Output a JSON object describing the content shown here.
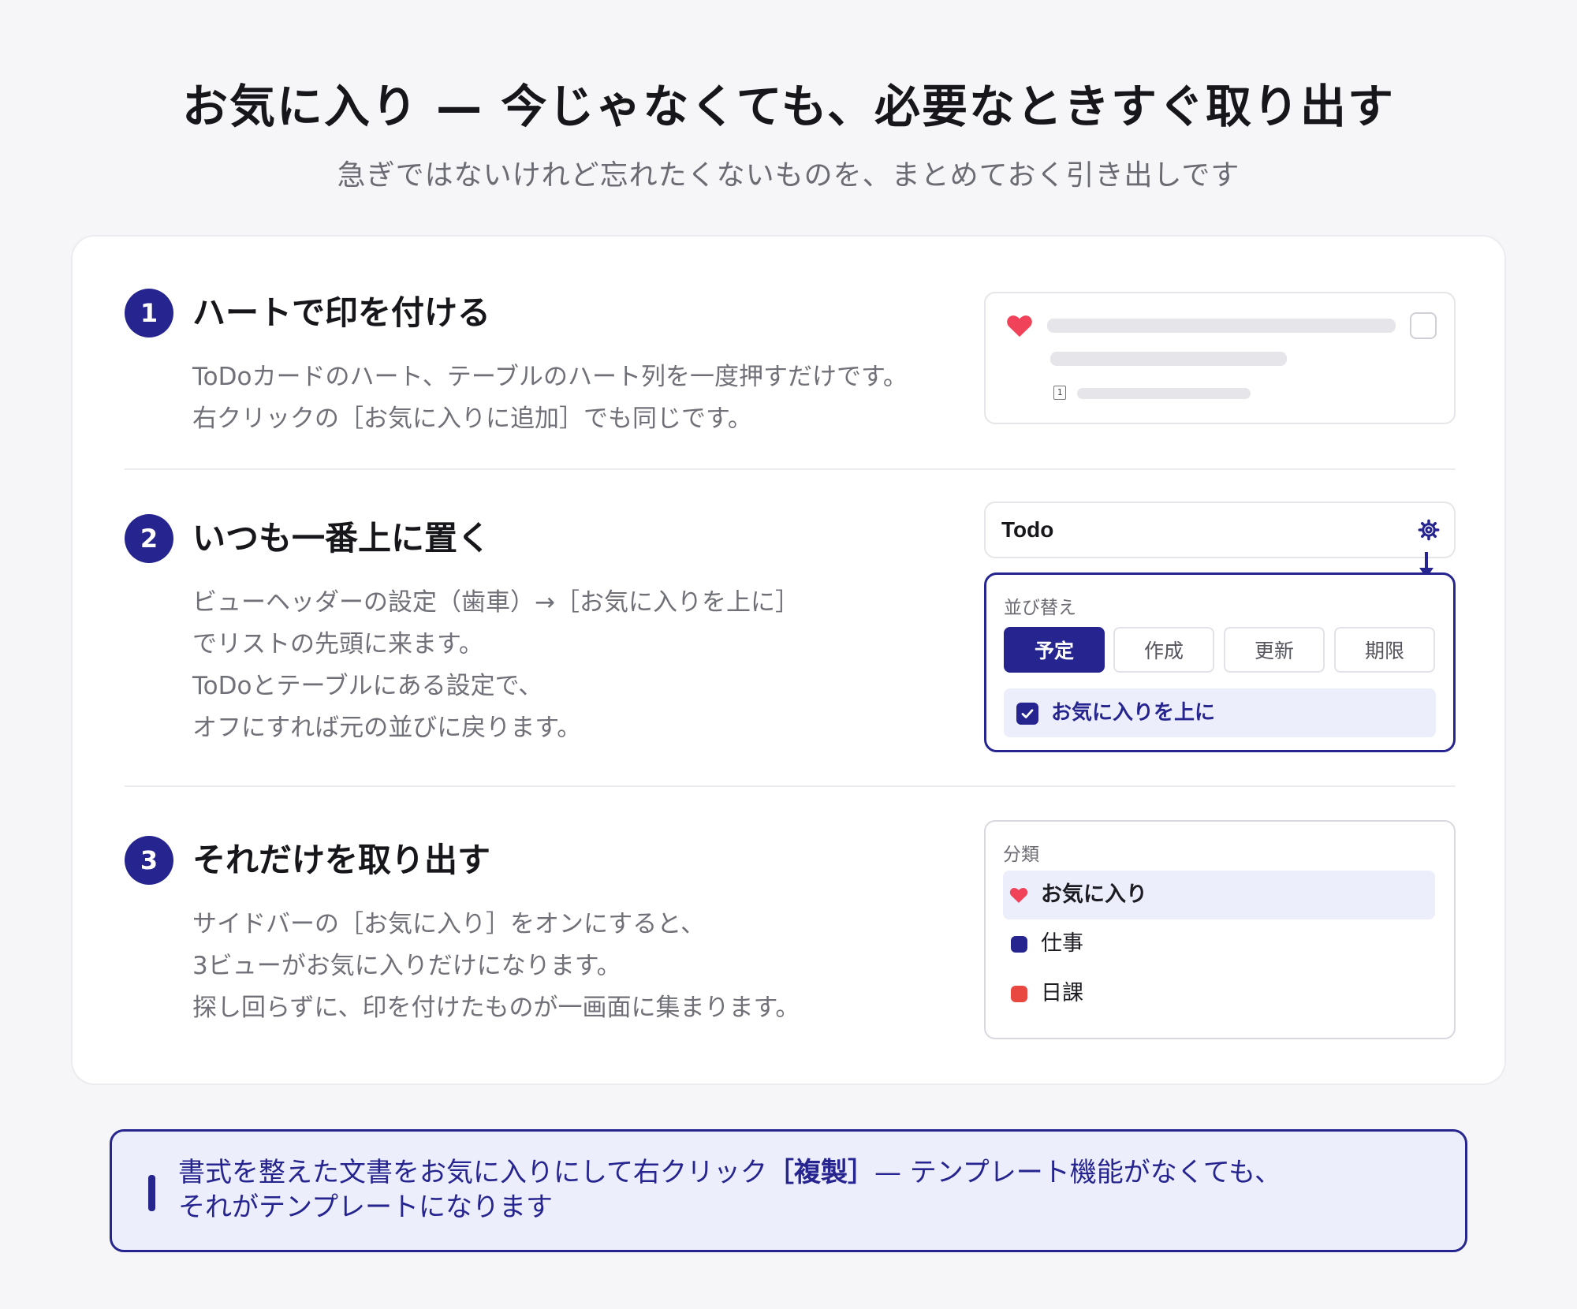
{
  "header": {
    "title": "お気に入り — 今じゃなくても、必要なときすぐ取り出す",
    "subtitle": "急ぎではないけれど忘れたくないものを、まとめておく引き出しです"
  },
  "steps": [
    {
      "number": "1",
      "title": "ハートで印を付ける",
      "lines": [
        "ToDoカードのハート、テーブルのハート列を一度押すだけです。",
        "右クリックの［お気に入りに追加］でも同じです。"
      ]
    },
    {
      "number": "2",
      "title": "いつも一番上に置く",
      "lines": [
        "ビューヘッダーの設定（歯車）→［お気に入りを上に］",
        "でリストの先頭に来ます。",
        "ToDoとテーブルにある設定で、",
        "オフにすれば元の並びに戻ります。"
      ]
    },
    {
      "number": "3",
      "title": "それだけを取り出す",
      "lines": [
        "サイドバーの［お気に入り］をオンにすると、",
        "3ビューがお気に入りだけになります。",
        "探し回らずに、印を付けたものが一画面に集まります。"
      ]
    }
  ],
  "mock_card": {
    "icons": [
      "heart-icon",
      "checkbox-icon",
      "calendar-icon"
    ],
    "calendar_glyph": "1"
  },
  "mock_view": {
    "title": "Todo",
    "sort_label": "並び替え",
    "sort_options": [
      "予定",
      "作成",
      "更新",
      "期限"
    ],
    "active_sort": "予定",
    "favorites_on_top_label": "お気に入りを上に",
    "favorites_on_top_checked": true
  },
  "mock_categories": {
    "header": "分類",
    "items": [
      {
        "label": "お気に入り",
        "icon": "heart-icon",
        "color": "#f0435a",
        "selected": true
      },
      {
        "label": "仕事",
        "icon": "dot",
        "color": "#26248f",
        "selected": false
      },
      {
        "label": "日課",
        "icon": "dot",
        "color": "#e8483f",
        "selected": false
      }
    ]
  },
  "tip": {
    "line1_before": "書式を整えた文書をお気に入りにして右クリック",
    "line1_bold": "［複製］",
    "line1_after": "— テンプレート機能がなくても、",
    "line2": "それがテンプレートになります"
  },
  "colors": {
    "accent": "#26248f",
    "heart": "#f0435a",
    "accent_bg": "#eceefb",
    "daily": "#e8483f"
  }
}
